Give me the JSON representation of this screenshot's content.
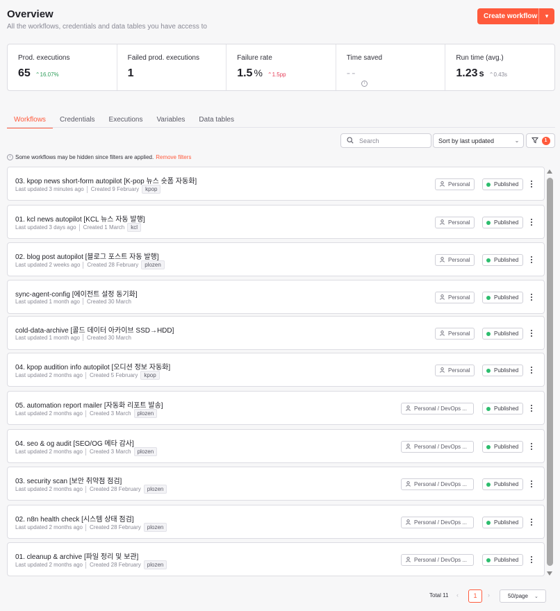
{
  "header": {
    "title": "Overview",
    "subtitle": "All the workflows, credentials and data tables you have access to",
    "create_label": "Create workflow"
  },
  "stats": [
    {
      "label": "Prod. executions",
      "value": "65",
      "delta": "16.07%",
      "trend": "up"
    },
    {
      "label": "Failed prod. executions",
      "value": "1",
      "delta": "",
      "trend": ""
    },
    {
      "label": "Failure rate",
      "value": "1.5",
      "unit": "%",
      "delta": "1.5pp",
      "trend": "up-bad"
    },
    {
      "label": "Time saved",
      "value": "--",
      "delta": "",
      "trend": ""
    },
    {
      "label": "Run time (avg.)",
      "value": "1.23",
      "unit": "s",
      "delta": "0.43s",
      "trend": "up-neutral"
    }
  ],
  "tabs": [
    "Workflows",
    "Credentials",
    "Executions",
    "Variables",
    "Data tables"
  ],
  "toolbar": {
    "search_placeholder": "Search",
    "sort_value": "Sort by last updated",
    "filter_count": "1"
  },
  "notice": {
    "text": "Some workflows may be hidden since filters are applied.",
    "link": "Remove filters"
  },
  "workflows": [
    {
      "name": "03. kpop news short-form autopilot [K-pop 뉴스 숏폼 자동화]",
      "updated": "Last updated 3 minutes ago",
      "created": "Created 9 February",
      "tag": "kpop",
      "owner": "Personal",
      "status": "Published"
    },
    {
      "name": "01. kcl news autopilot [KCL 뉴스 자동 발행]",
      "updated": "Last updated 3 days ago",
      "created": "Created 1 March",
      "tag": "kcl",
      "owner": "Personal",
      "status": "Published"
    },
    {
      "name": "02. blog post autopilot [블로그 포스트 자동 발행]",
      "updated": "Last updated 2 weeks ago",
      "created": "Created 28 February",
      "tag": "plozen",
      "owner": "Personal",
      "status": "Published"
    },
    {
      "name": "sync-agent-config [에이전트 설정 동기화]",
      "updated": "Last updated 1 month ago",
      "created": "Created 30 March",
      "tag": "",
      "owner": "Personal",
      "status": "Published"
    },
    {
      "name": "cold-data-archive [콜드 데이터 아카이브 SSD→HDD]",
      "updated": "Last updated 1 month ago",
      "created": "Created 30 March",
      "tag": "",
      "owner": "Personal",
      "status": "Published"
    },
    {
      "name": "04. kpop audition info autopilot [오디션 정보 자동화]",
      "updated": "Last updated 2 months ago",
      "created": "Created 5 February",
      "tag": "kpop",
      "owner": "Personal",
      "status": "Published"
    },
    {
      "name": "05. automation report mailer [자동화 리포트 발송]",
      "updated": "Last updated 2 months ago",
      "created": "Created 3 March",
      "tag": "plozen",
      "owner": "Personal / DevOps ...",
      "status": "Published"
    },
    {
      "name": "04. seo & og audit [SEO/OG 메타 감사]",
      "updated": "Last updated 2 months ago",
      "created": "Created 3 March",
      "tag": "plozen",
      "owner": "Personal / DevOps ...",
      "status": "Published"
    },
    {
      "name": "03. security scan [보안 취약점 점검]",
      "updated": "Last updated 2 months ago",
      "created": "Created 28 February",
      "tag": "plozen",
      "owner": "Personal / DevOps ...",
      "status": "Published"
    },
    {
      "name": "02. n8n health check [시스템 상태 점검]",
      "updated": "Last updated 2 months ago",
      "created": "Created 28 February",
      "tag": "plozen",
      "owner": "Personal / DevOps ...",
      "status": "Published"
    },
    {
      "name": "01. cleanup & archive [파일 정리 및 보관]",
      "updated": "Last updated 2 months ago",
      "created": "Created 28 February",
      "tag": "plozen",
      "owner": "Personal / DevOps ...",
      "status": "Published"
    }
  ],
  "pagination": {
    "total": "Total 11",
    "current": "1",
    "per_page": "50/page"
  }
}
